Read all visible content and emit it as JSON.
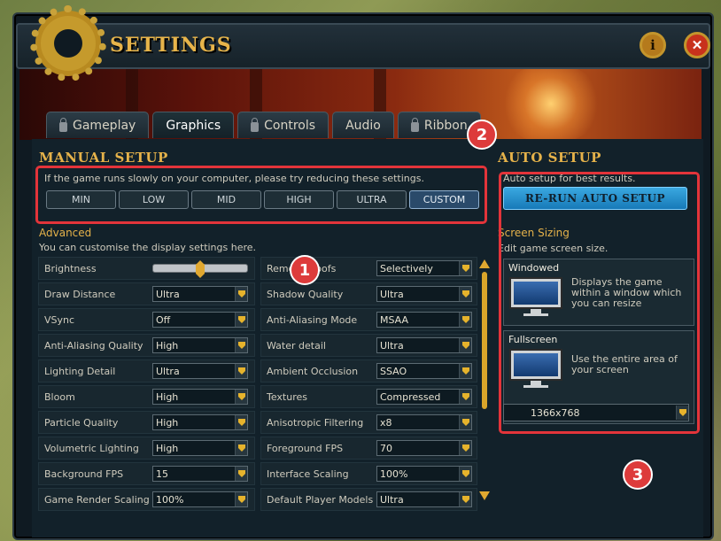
{
  "header": {
    "title": "SETTINGS"
  },
  "tabs": [
    {
      "label": "Gameplay",
      "locked": true
    },
    {
      "label": "Graphics",
      "locked": false
    },
    {
      "label": "Controls",
      "locked": true
    },
    {
      "label": "Audio",
      "locked": false
    },
    {
      "label": "Ribbon",
      "locked": true
    }
  ],
  "manual": {
    "title": "MANUAL SETUP",
    "hint": "If the game runs slowly on your computer, please try reducing these settings.",
    "presets": [
      "MIN",
      "LOW",
      "MID",
      "HIGH",
      "ULTRA",
      "CUSTOM"
    ],
    "selected_preset": "CUSTOM",
    "advanced_title": "Advanced",
    "advanced_desc": "You can customise the display settings here."
  },
  "left_settings": [
    {
      "label": "Brightness",
      "type": "slider",
      "level": 0.5
    },
    {
      "label": "Draw Distance",
      "value": "Ultra"
    },
    {
      "label": "VSync",
      "value": "Off"
    },
    {
      "label": "Anti-Aliasing Quality",
      "value": "High"
    },
    {
      "label": "Lighting Detail",
      "value": "Ultra"
    },
    {
      "label": "Bloom",
      "value": "High"
    },
    {
      "label": "Particle Quality",
      "value": "High"
    },
    {
      "label": "Volumetric Lighting",
      "value": "High"
    },
    {
      "label": "Background FPS",
      "value": "15"
    },
    {
      "label": "Game Render Scaling",
      "value": "100%"
    }
  ],
  "right_settings": [
    {
      "label": "Remove Roofs",
      "value": "Selectively"
    },
    {
      "label": "Shadow Quality",
      "value": "Ultra"
    },
    {
      "label": "Anti-Aliasing Mode",
      "value": "MSAA"
    },
    {
      "label": "Water detail",
      "value": "Ultra"
    },
    {
      "label": "Ambient Occlusion",
      "value": "SSAO"
    },
    {
      "label": "Textures",
      "value": "Compressed"
    },
    {
      "label": "Anisotropic Filtering",
      "value": "x8"
    },
    {
      "label": "Foreground FPS",
      "value": "70"
    },
    {
      "label": "Interface Scaling",
      "value": "100%"
    },
    {
      "label": "Default Player Models",
      "value": "Ultra"
    }
  ],
  "auto": {
    "title": "AUTO SETUP",
    "hint": "Auto setup for best results.",
    "button": "RE-RUN AUTO SETUP",
    "screen_title": "Screen Sizing",
    "screen_desc": "Edit game screen size.",
    "windowed_label": "Windowed",
    "windowed_desc": "Displays the game within a window which you can resize",
    "fullscreen_label": "Fullscreen",
    "fullscreen_desc": "Use the entire area of your screen",
    "resolution": "1366x768"
  },
  "callouts": [
    "1",
    "2",
    "3"
  ],
  "colors": {
    "accent": "#e5b24a",
    "highlight_box": "#e3343a",
    "callout": "#dd3b3b",
    "button_blue": "#1f8fd0"
  }
}
